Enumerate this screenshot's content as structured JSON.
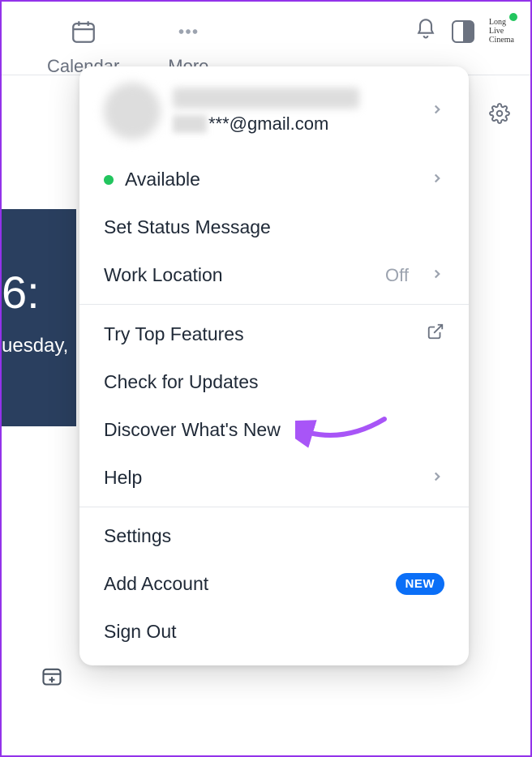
{
  "tabs": {
    "calendar": "Calendar",
    "more": "More"
  },
  "logo": {
    "line1": "Long",
    "line2": "Live",
    "line3": "Cinema"
  },
  "profile": {
    "email": "***@gmail.com"
  },
  "status": {
    "available": "Available",
    "set_message": "Set Status Message",
    "work_location": "Work Location",
    "work_location_value": "Off"
  },
  "features": {
    "try_top": "Try Top Features",
    "check_updates": "Check for Updates",
    "discover": "Discover What's New",
    "help": "Help"
  },
  "account": {
    "settings": "Settings",
    "add_account": "Add Account",
    "new_badge": "NEW",
    "sign_out": "Sign Out"
  },
  "background": {
    "time": "6:",
    "day": "uesday,"
  }
}
